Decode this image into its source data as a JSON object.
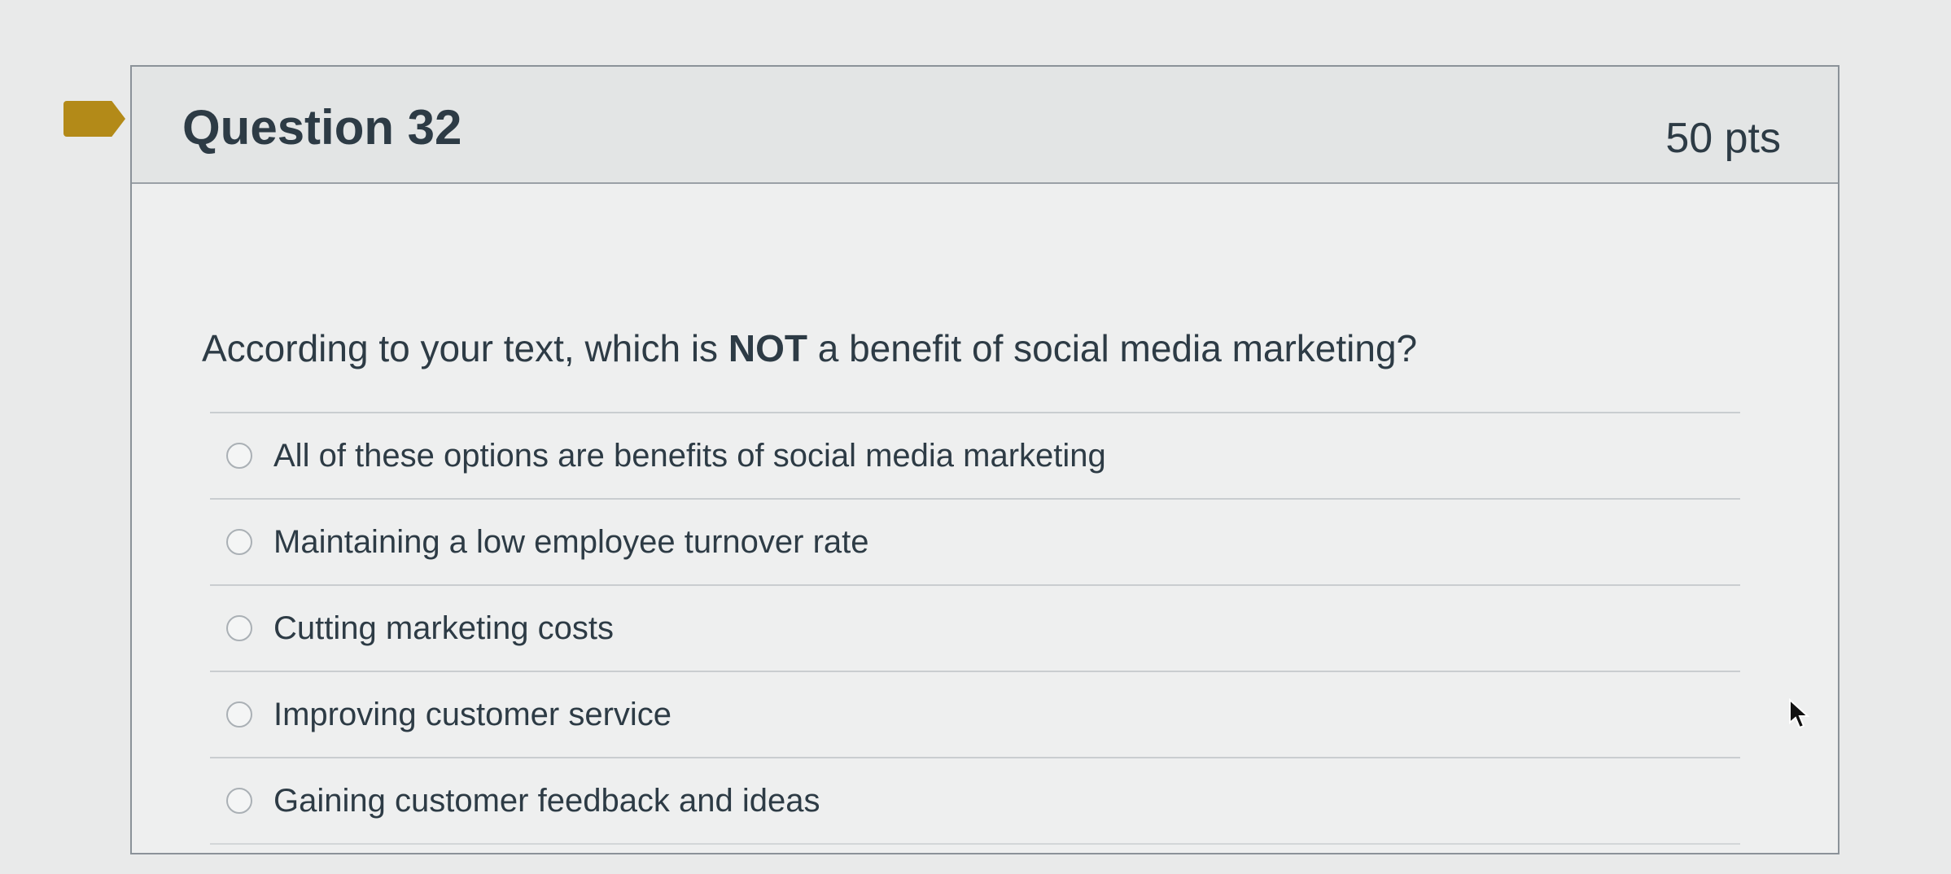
{
  "question": {
    "title": "Question 32",
    "points": "50 pts",
    "text_before": "According to your text, which is ",
    "text_emphasis": "NOT",
    "text_after": " a benefit of social media marketing?",
    "answers": [
      {
        "label": "All of these options are benefits of social media marketing",
        "selected": false
      },
      {
        "label": "Maintaining a low employee turnover rate",
        "selected": false
      },
      {
        "label": "Cutting marketing costs",
        "selected": false
      },
      {
        "label": "Improving customer service",
        "selected": false
      },
      {
        "label": "Gaining customer feedback and ideas",
        "selected": false
      }
    ]
  },
  "icons": {
    "flag": "bookmark-flag-icon",
    "cursor": "mouse-pointer-icon"
  },
  "colors": {
    "flag": "#b38a18",
    "text": "#2d3b45"
  }
}
